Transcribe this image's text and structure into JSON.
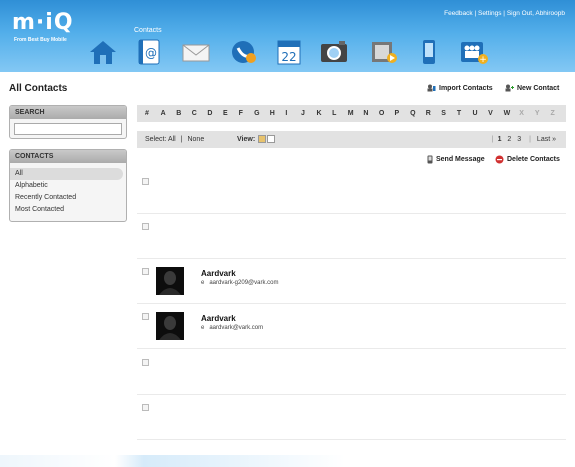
{
  "header": {
    "logo_text": "m·iQ",
    "tagline": "From Best Buy Mobile",
    "links": [
      "Feedback",
      "Settings",
      "Sign Out, Abhiroopb"
    ],
    "separator": "|",
    "active_nav_label": "Contacts",
    "nav_icons": [
      "home-icon",
      "contacts-icon",
      "mail-icon",
      "phone-icon",
      "calendar-icon",
      "photos-icon",
      "video-icon",
      "device-icon",
      "groups-icon"
    ],
    "calendar_day": "22"
  },
  "page": {
    "title": "All Contacts",
    "import_label": "Import Contacts",
    "new_contact_label": "New Contact"
  },
  "sidebar": {
    "search_heading": "SEARCH",
    "search_value": "",
    "contacts_heading": "CONTACTS",
    "filters": [
      "All",
      "Alphabetic",
      "Recently Contacted",
      "Most Contacted"
    ],
    "selected_filter": "All"
  },
  "alphabet": {
    "letters": [
      "#",
      "A",
      "B",
      "C",
      "D",
      "E",
      "F",
      "G",
      "H",
      "I",
      "J",
      "K",
      "L",
      "M",
      "N",
      "O",
      "P",
      "Q",
      "R",
      "S",
      "T",
      "U",
      "V",
      "W",
      "X",
      "Y",
      "Z"
    ],
    "disabled": [
      "X",
      "Y",
      "Z"
    ]
  },
  "select_bar": {
    "select_label": "Select: All",
    "none_label": "None",
    "view_label": "View:",
    "pages": [
      "1",
      "2",
      "3"
    ],
    "current_page": "1",
    "last_label": "Last »"
  },
  "actions": {
    "send_message": "Send Message",
    "delete_contacts": "Delete Contacts"
  },
  "contacts": [
    {
      "name": "",
      "email_label": "",
      "email": ""
    },
    {
      "name": "",
      "email_label": "",
      "email": ""
    },
    {
      "name": "Aardvark",
      "email_label": "e",
      "email": "aardvark-g209@vark.com"
    },
    {
      "name": "Aardvark",
      "email_label": "e",
      "email": "aardvark@vark.com"
    },
    {
      "name": "",
      "email_label": "",
      "email": ""
    },
    {
      "name": "",
      "email_label": "",
      "email": ""
    }
  ],
  "colors": {
    "header_top": "#2f8fd6",
    "header_bottom": "#83c8f4",
    "bar_gray": "#e2e2e2",
    "delete_red": "#d03030"
  }
}
